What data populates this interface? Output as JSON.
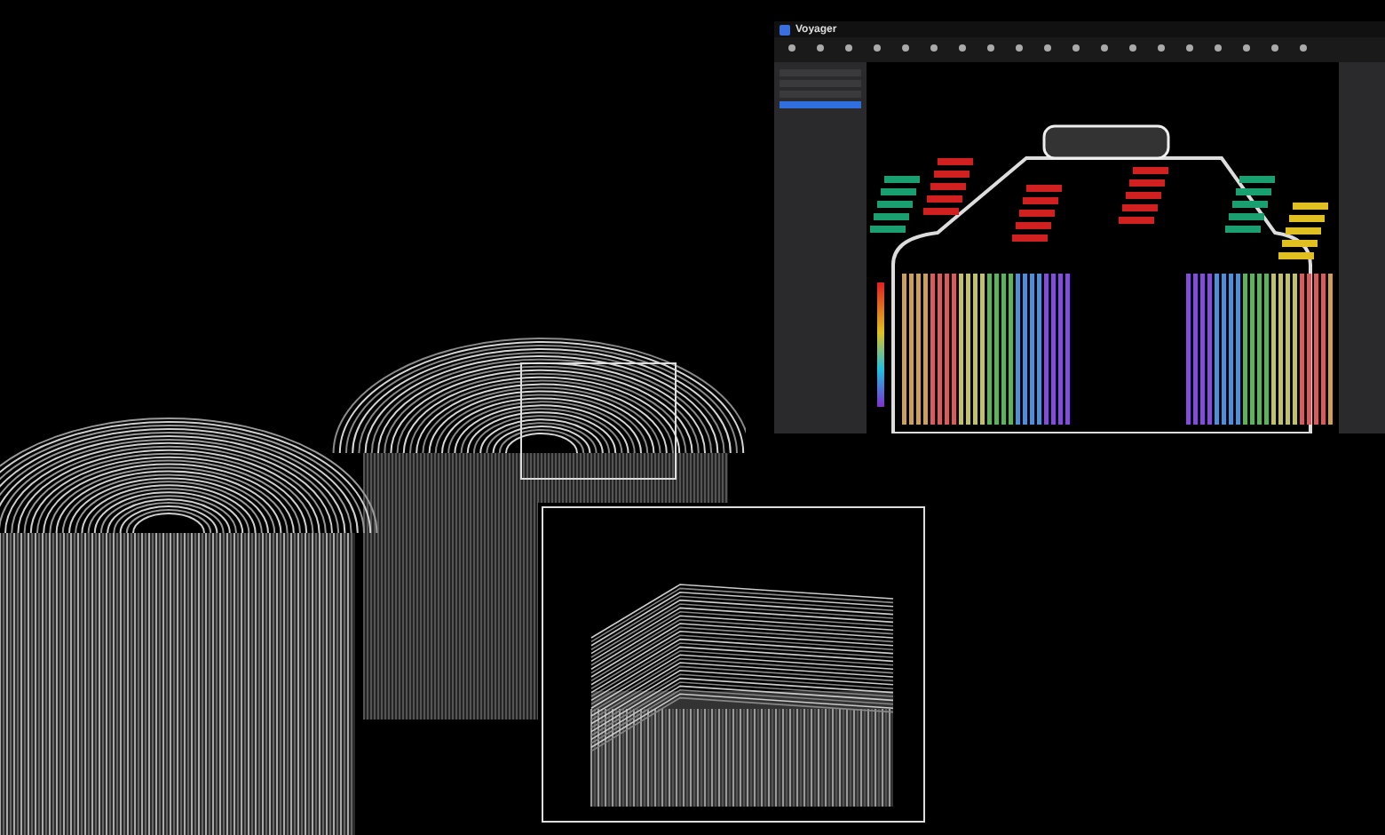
{
  "app_window": {
    "title": "Voyager"
  },
  "sidebar": {
    "items": [
      {
        "selected": false
      },
      {
        "selected": false
      },
      {
        "selected": false
      },
      {
        "selected": true
      }
    ]
  }
}
